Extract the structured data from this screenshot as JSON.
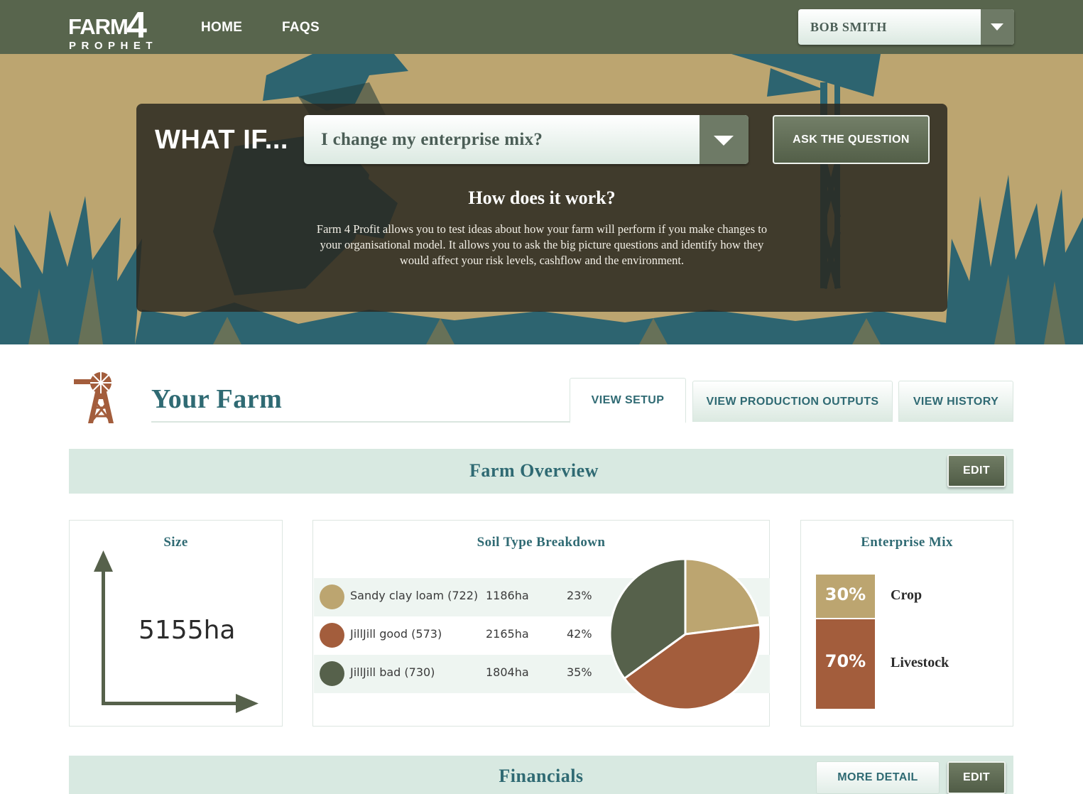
{
  "nav": {
    "logo_main": "FARM",
    "logo_num": "4",
    "logo_sub": "PROPHET",
    "home": "HOME",
    "faqs": "FAQS",
    "user": "BOB SMITH"
  },
  "hero": {
    "whatif": "WHAT IF...",
    "question": "I change my enterprise mix?",
    "ask_button": "ASK THE QUESTION",
    "how_title": "How does it work?",
    "how_body": "Farm 4 Profit allows you to test ideas about how your farm will perform if you make changes to your organisational model. It allows you to ask the big picture questions and identify how they would affect your risk levels, cashflow and the environment."
  },
  "farm": {
    "title": "Your Farm",
    "tabs": [
      {
        "label": "VIEW SETUP",
        "active": true
      },
      {
        "label": "VIEW PRODUCTION OUTPUTS",
        "active": false
      },
      {
        "label": "VIEW HISTORY",
        "active": false
      }
    ]
  },
  "overview": {
    "title": "Farm Overview",
    "edit": "EDIT",
    "size": {
      "title": "Size",
      "value": "5155ha"
    },
    "soil": {
      "title": "Soil Type Breakdown",
      "rows": [
        {
          "name": "Sandy clay loam (722)",
          "area": "1186ha",
          "pct": "23%",
          "color": "#bca570"
        },
        {
          "name": "JillJill good (573)",
          "area": "2165ha",
          "pct": "42%",
          "color": "#a35d3c"
        },
        {
          "name": "JillJill bad (730)",
          "area": "1804ha",
          "pct": "35%",
          "color": "#56614b"
        }
      ]
    },
    "mix": {
      "title": "Enterprise Mix",
      "items": [
        {
          "pct": "30%",
          "label": "Crop",
          "color": "#bca570"
        },
        {
          "pct": "70%",
          "label": "Livestock",
          "color": "#a35d3c"
        }
      ]
    }
  },
  "financials": {
    "title": "Financials",
    "more": "MORE DETAIL",
    "edit": "EDIT"
  },
  "chart_data": {
    "type": "pie",
    "title": "Soil Type Breakdown",
    "categories": [
      "Sandy clay loam (722)",
      "JillJill good (573)",
      "JillJill bad (730)"
    ],
    "values": [
      23,
      42,
      35
    ],
    "colors": [
      "#bca570",
      "#a35d3c",
      "#56614b"
    ]
  }
}
